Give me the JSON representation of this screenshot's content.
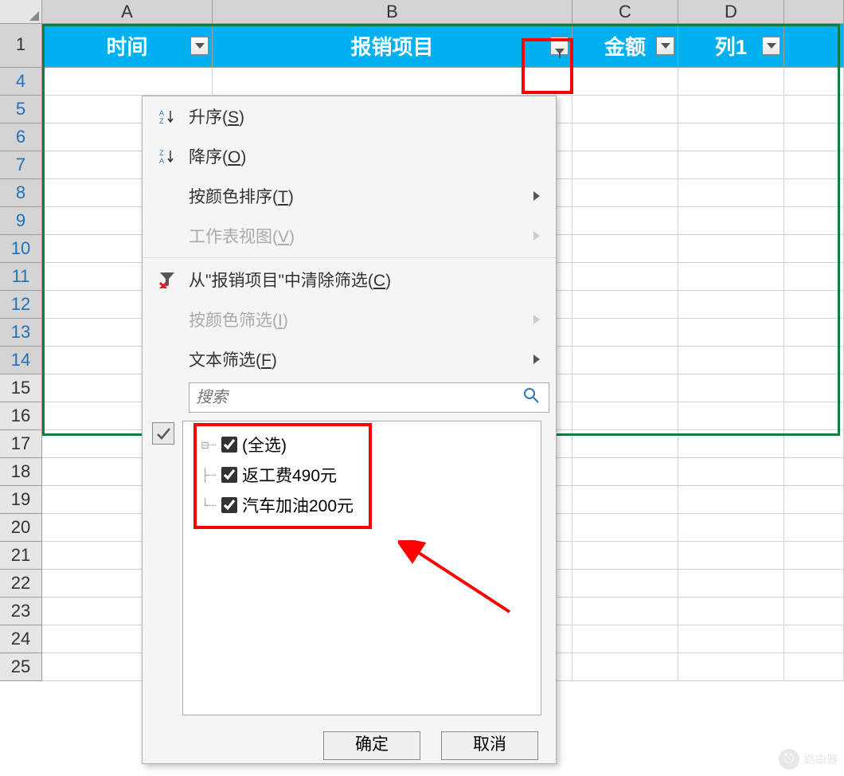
{
  "columns": {
    "A": "A",
    "B": "B",
    "C": "C",
    "D": "D"
  },
  "header_row_num": "1",
  "filtered_rows": [
    "4",
    "5",
    "6",
    "7",
    "8",
    "9",
    "10",
    "11",
    "12",
    "13",
    "14"
  ],
  "normal_rows": [
    "15",
    "16",
    "17",
    "18",
    "19",
    "20",
    "21",
    "22",
    "23",
    "24",
    "25"
  ],
  "headers": {
    "A": "时间",
    "B": "报销项目",
    "C": "金额",
    "D": "列1"
  },
  "dropdown": {
    "sort_asc": "升序(",
    "sort_asc_key": "S",
    "sort_asc_end": ")",
    "sort_desc": "降序(",
    "sort_desc_key": "O",
    "sort_desc_end": ")",
    "color_sort": "按颜色排序(",
    "color_sort_key": "T",
    "color_sort_end": ")",
    "sheet_view": "工作表视图(",
    "sheet_view_key": "V",
    "sheet_view_end": ")",
    "clear_filter": "从\"报销项目\"中清除筛选(",
    "clear_filter_key": "C",
    "clear_filter_end": ")",
    "color_filter": "按颜色筛选(",
    "color_filter_key": "I",
    "color_filter_end": ")",
    "text_filter": "文本筛选(",
    "text_filter_key": "F",
    "text_filter_end": ")",
    "search_placeholder": "搜索",
    "tree": {
      "all": "(全选)",
      "items": [
        "返工费490元",
        "汽车加油200元"
      ]
    },
    "ok": "确定",
    "cancel": "取消"
  },
  "watermark": "路由器"
}
